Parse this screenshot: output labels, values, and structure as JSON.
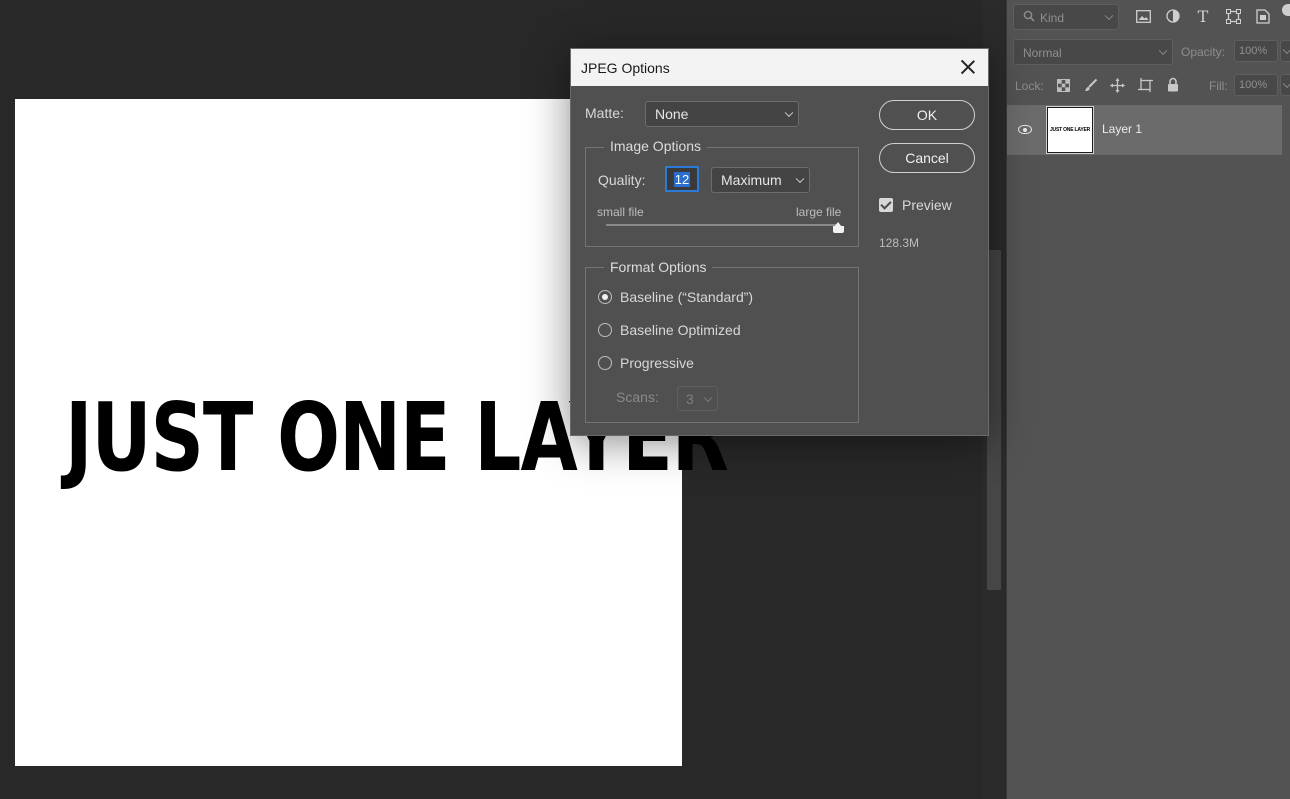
{
  "canvas": {
    "text": "JUST ONE LAYER"
  },
  "layers_panel": {
    "filter_kind": "Kind",
    "blend_mode": "Normal",
    "opacity_label": "Opacity:",
    "opacity_value": "100%",
    "lock_label": "Lock:",
    "fill_label": "Fill:",
    "fill_value": "100%",
    "layers": [
      {
        "name": "Layer 1",
        "visible": true,
        "thumb_text": "JUST ONE LAYER"
      }
    ]
  },
  "dialog": {
    "title": "JPEG Options",
    "matte_label": "Matte:",
    "matte_value": "None",
    "image_options_title": "Image Options",
    "quality_label": "Quality:",
    "quality_value": "12",
    "quality_preset": "Maximum",
    "slider_min_label": "small file",
    "slider_max_label": "large file",
    "slider_value_fraction": 1.0,
    "format_options_title": "Format Options",
    "format_options": [
      {
        "label": "Baseline (“Standard”)",
        "selected": true
      },
      {
        "label": "Baseline Optimized",
        "selected": false
      },
      {
        "label": "Progressive",
        "selected": false
      }
    ],
    "scans_label": "Scans:",
    "scans_value": "3",
    "ok_label": "OK",
    "cancel_label": "Cancel",
    "preview_label": "Preview",
    "preview_checked": true,
    "file_size": "128.3M"
  },
  "colors": {
    "accent": "#2a7ad6",
    "app_bg": "#282828",
    "panel_bg": "#535353",
    "dialog_bg": "#505050"
  }
}
